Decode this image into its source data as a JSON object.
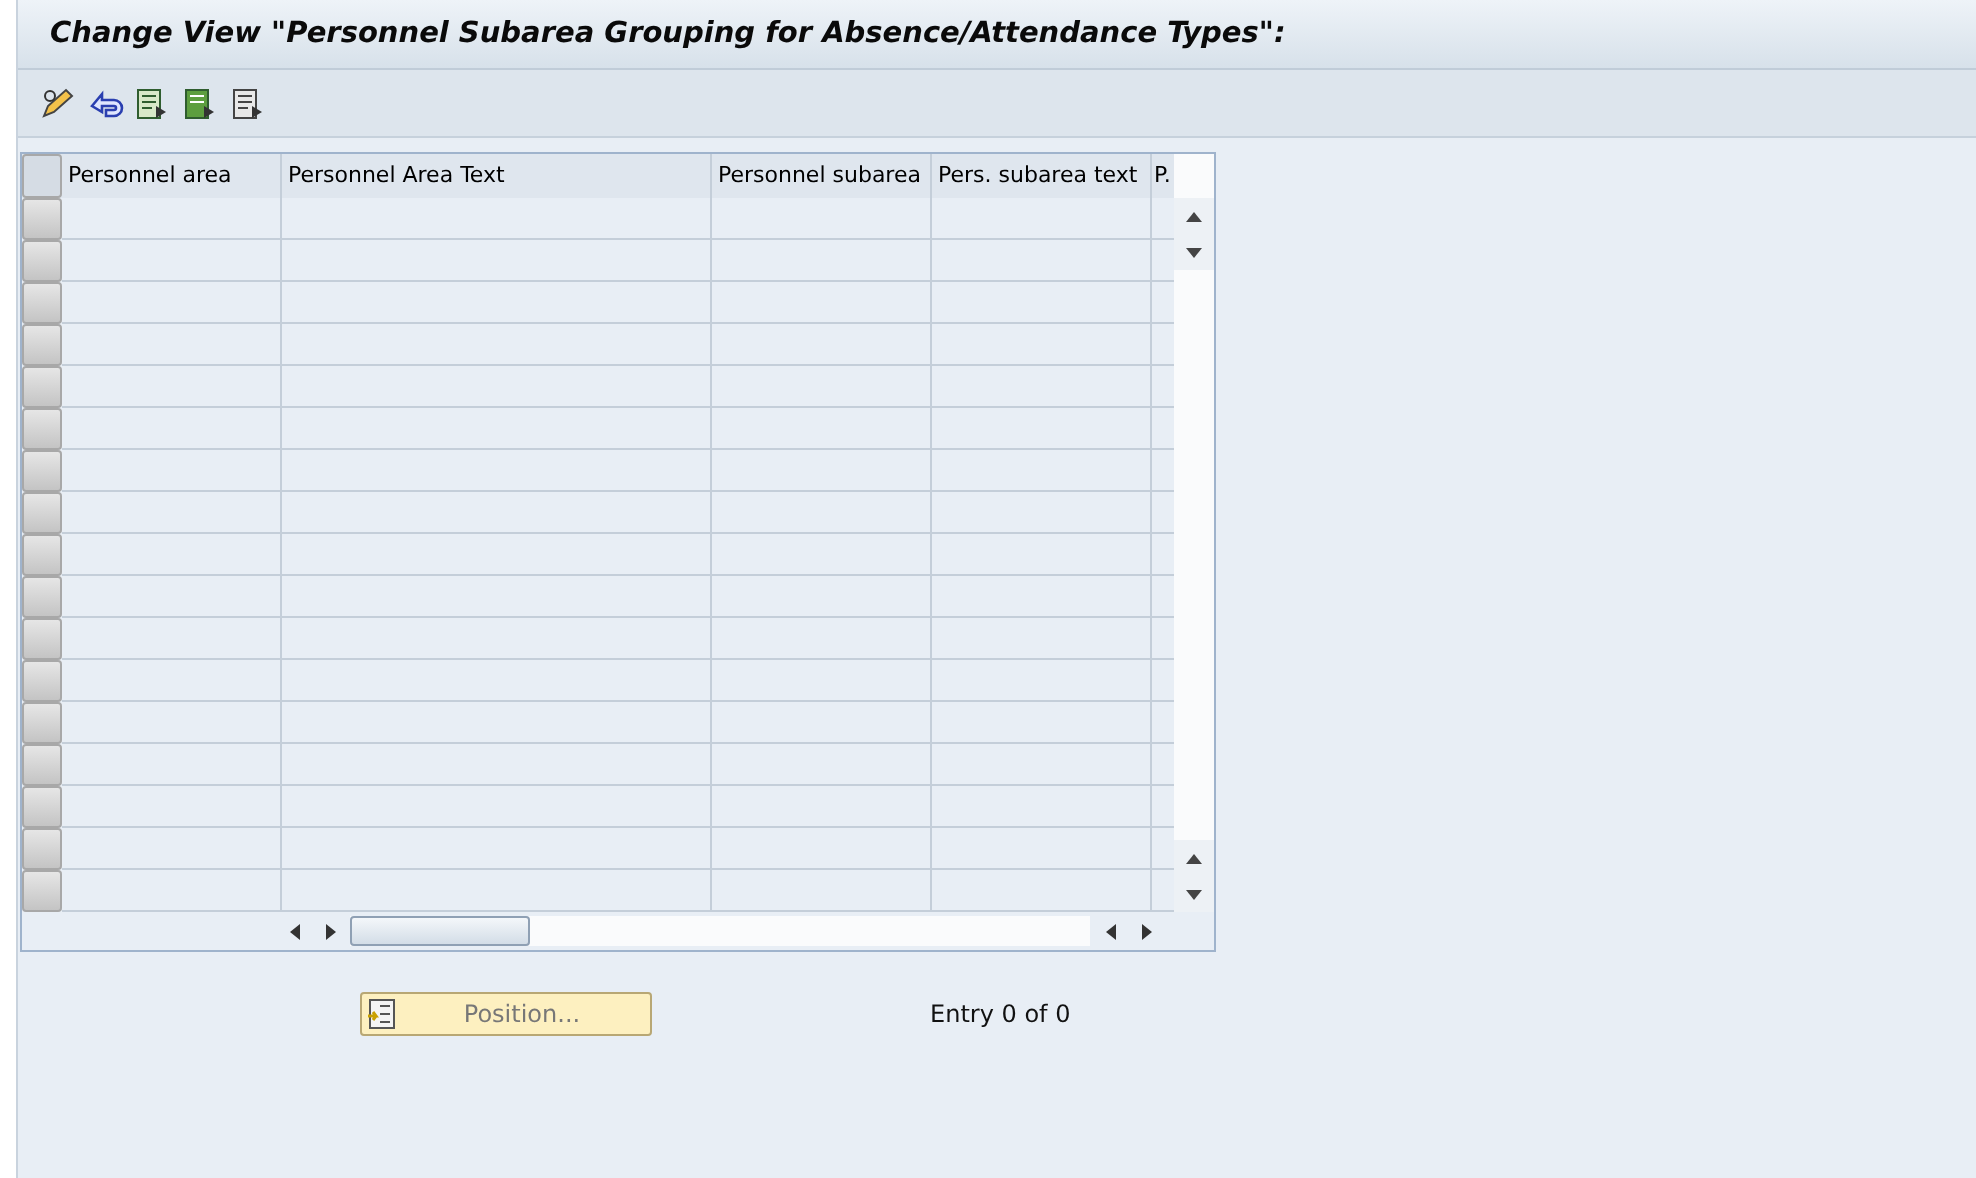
{
  "window": {
    "title": "Change View \"Personnel Subarea Grouping for Absence/Attendance Types\":"
  },
  "table": {
    "columns": [
      "Personnel area",
      "Personnel Area Text",
      "Personnel subarea",
      "Pers. subarea text",
      "P."
    ]
  },
  "position_button": {
    "label": "Position..."
  },
  "entry_info": "Entry 0 of 0"
}
